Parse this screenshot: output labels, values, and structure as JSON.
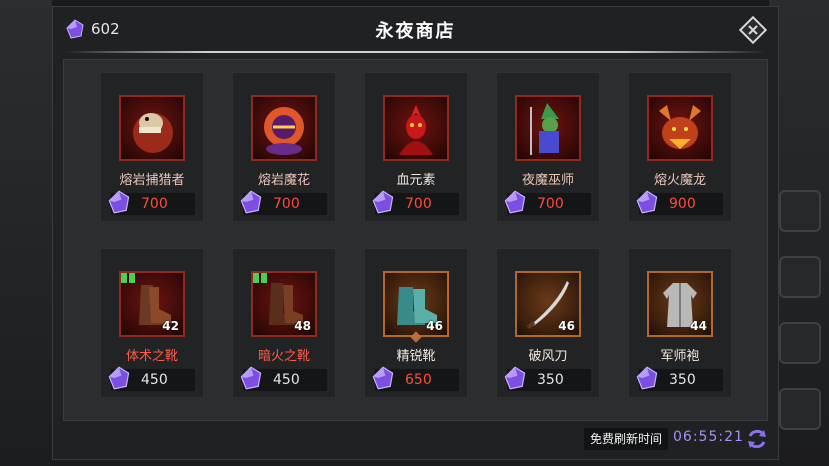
{
  "title": "永夜商店",
  "currency": {
    "amount": "602",
    "icon": "purple-gem-icon"
  },
  "colors": {
    "price_red": "#ff4a3d",
    "gem": "#8b5cf6",
    "timer": "#a58ff5"
  },
  "rows": [
    [
      {
        "name": "熔岩捕猎者",
        "price": "700",
        "icon": "lava-hunter-portrait"
      },
      {
        "name": "熔岩魔花",
        "price": "700",
        "icon": "lava-flower-portrait"
      },
      {
        "name": "血元素",
        "price": "700",
        "icon": "blood-elemental-portrait"
      },
      {
        "name": "夜魔巫师",
        "price": "700",
        "icon": "night-wizard-portrait"
      },
      {
        "name": "熔火魔龙",
        "price": "900",
        "icon": "fire-dragon-portrait"
      }
    ],
    [
      {
        "name": "体术之靴",
        "price": "450",
        "level": "42",
        "icon": "boots-icon"
      },
      {
        "name": "暗火之靴",
        "price": "450",
        "level": "48",
        "icon": "dark-boots-icon"
      },
      {
        "name": "精锐靴",
        "price": "650",
        "level": "46",
        "icon": "elite-boots-icon"
      },
      {
        "name": "破风刀",
        "price": "350",
        "level": "46",
        "icon": "sabre-icon"
      },
      {
        "name": "军师袍",
        "price": "350",
        "level": "44",
        "icon": "robe-icon"
      }
    ]
  ],
  "footer": {
    "refresh_label": "免费刷新时间",
    "timer": "06:55:21"
  }
}
